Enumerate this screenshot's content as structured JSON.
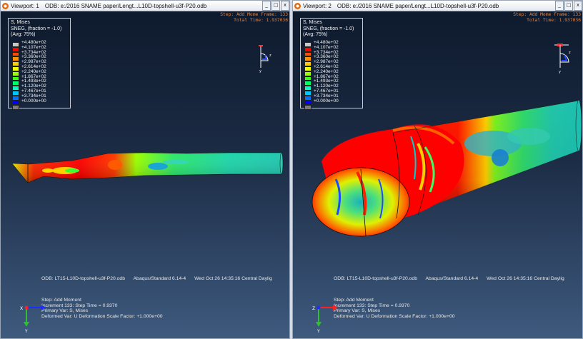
{
  "viewports": [
    {
      "title": "Viewport: 1",
      "odb_path": "ODB: e:/2016 SNAME paper/Lengt...L10D-topshell-u3f-P20.odb",
      "win_buttons": [
        "_",
        "□",
        "x"
      ],
      "legend": {
        "title_lines": [
          "S, Mises",
          "SNEG, (fraction = -1.0)",
          "(Avg: 75%)"
        ],
        "values": [
          "+4.480e+02",
          "+4.107e+02",
          "+3.734e+02",
          "+3.360e+02",
          "+2.987e+02",
          "+2.614e+02",
          "+2.240e+02",
          "+1.867e+02",
          "+1.493e+02",
          "+1.120e+02",
          "+7.467e+01",
          "+3.734e+01",
          "+0.000e+00"
        ],
        "colors": [
          "#c8c8c8",
          "#ff0000",
          "#ff4a00",
          "#ff9000",
          "#ffcc00",
          "#f0ff00",
          "#98ff00",
          "#3aff10",
          "#00ff66",
          "#00ffc0",
          "#00c8ff",
          "#0070ff",
          "#0000ff",
          "#7a7a7a"
        ]
      },
      "step_info": [],
      "odb_line": {
        "file": "ODB: LT15-L10D-topshell-u3f-P20.odb",
        "solver": "Abaqus/Standard 6.14-4",
        "date": "Wed Oct 26 14:35:16 Central Daylig"
      },
      "info": [
        "Step: Add Moment",
        "Increment    133: Step Time =    0.9370",
        "Primary Var: S, Mises",
        "Deformed Var: U   Deformation Scale Factor: +1.000e+00"
      ],
      "triad_labels": {
        "y": "Y",
        "z": "Z",
        "x": "X"
      }
    },
    {
      "title": "Viewport: 2",
      "odb_path": "ODB: e:/2016 SNAME paper/Lengt...L10D-topshell-u3f-P20.odb",
      "win_buttons": [
        "_",
        "□",
        "x"
      ],
      "legend": {
        "title_lines": [
          "S, Mises",
          "SNEG, (fraction = -1.0)",
          "(Avg: 75%)"
        ],
        "values": [
          "+4.480e+02",
          "+4.107e+02",
          "+3.734e+02",
          "+3.360e+02",
          "+2.987e+02",
          "+2.614e+02",
          "+2.240e+02",
          "+1.867e+02",
          "+1.493e+02",
          "+1.120e+02",
          "+7.467e+01",
          "+3.734e+01",
          "+0.000e+00"
        ],
        "colors": [
          "#c8c8c8",
          "#ff0000",
          "#ff4a00",
          "#ff9000",
          "#ffcc00",
          "#f0ff00",
          "#98ff00",
          "#3aff10",
          "#00ff66",
          "#00ffc0",
          "#00c8ff",
          "#0070ff",
          "#0000ff",
          "#7a7a7a"
        ]
      },
      "step_info": [
        "Step: Add Mome Frame: 133",
        "Total Time: 1.937036"
      ],
      "odb_line": {
        "file": "ODB: LT15-L10D-topshell-u3f-P20.odb",
        "solver": "Abaqus/Standard 6.14-4",
        "date": "Wed Oct 26 14:35:16 Central Daylig"
      },
      "info": [
        "Step: Add Moment",
        "Increment    133: Step Time =    0.9370",
        "Primary Var: S, Mises",
        "Deformed Var: U   Deformation Scale Factor: +1.000e+00"
      ],
      "triad_labels": {
        "y": "Y",
        "z": "Z",
        "x": "X"
      }
    }
  ],
  "viewport1_step_info": [
    "Step: Add Mome Frame: 133",
    "Total Time: 1.937036"
  ],
  "colors": {
    "step_text": "#e8823a",
    "background_top": "#0e1a2d",
    "background_bottom": "#3e5a7e"
  }
}
